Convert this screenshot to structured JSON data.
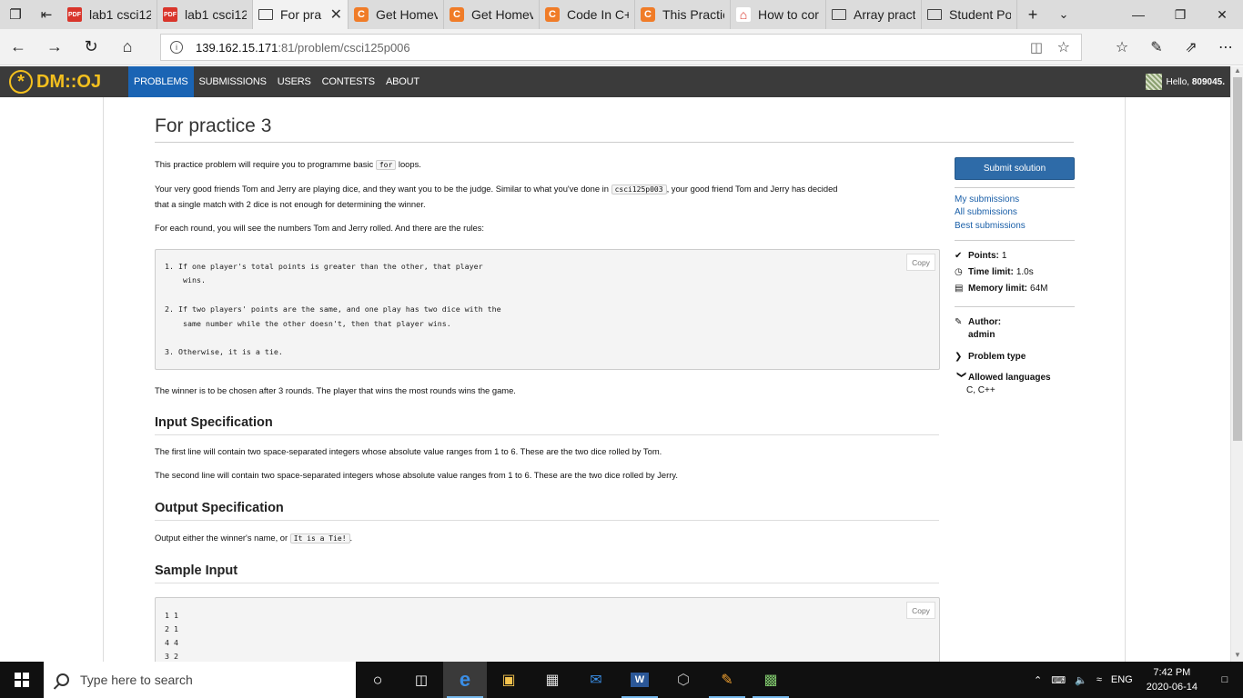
{
  "browser": {
    "tabs": [
      {
        "label": "lab1 csci12",
        "favicon": "pdf"
      },
      {
        "label": "lab1 csci12",
        "favicon": "pdf"
      },
      {
        "label": "For pra",
        "favicon": "page",
        "active": true
      },
      {
        "label": "Get Homev",
        "favicon": "c"
      },
      {
        "label": "Get Homev",
        "favicon": "c"
      },
      {
        "label": "Code In C+",
        "favicon": "c"
      },
      {
        "label": "This Practic",
        "favicon": "c"
      },
      {
        "label": "How to cor",
        "favicon": "acrobat"
      },
      {
        "label": "Array pract",
        "favicon": "page"
      },
      {
        "label": "Student Po",
        "favicon": "page"
      }
    ],
    "url_host": "139.162.15.171",
    "url_path": ":81/problem/csci125p006"
  },
  "site": {
    "logo_text": "DM::OJ",
    "nav": {
      "problems": "PROBLEMS",
      "submissions": "SUBMISSIONS",
      "users": "USERS",
      "contests": "CONTESTS",
      "about": "ABOUT"
    },
    "greeting_prefix": "Hello, ",
    "username": "809045."
  },
  "problem": {
    "title": "For practice 3",
    "intro_pre": "This practice problem will require you to programme basic ",
    "intro_code": "for",
    "intro_post": " loops.",
    "p2_pre": "Your very good friends Tom and Jerry are playing dice, and they want you to be the judge. Similar to what you've done in ",
    "p2_code": "csci125p003",
    "p2_post": ", your good friend Tom and Jerry has decided",
    "p2_line2": "that a single match with 2 dice is not enough for determining the winner.",
    "p3": "For each round, you will see the numbers Tom and Jerry rolled. And there are the rules:",
    "rules": [
      "1. If one player's total points is greater than the other, that player",
      "    wins.",
      "2. If two players' points are the same, and one play has two dice with the",
      "    same number while the other doesn't, then that player wins.",
      "3. Otherwise, it is a tie."
    ],
    "copy_label": "Copy",
    "p4": "The winner is to be chosen after 3 rounds. The player that wins the most rounds wins the game.",
    "input_heading": "Input Specification",
    "input_l1": "The first line will contain two space-separated integers whose absolute value ranges from 1 to 6. These are the two dice rolled by Tom.",
    "input_l2": "The second line will contain two space-separated integers whose absolute value ranges from 1 to 6. These are the two dice rolled by Jerry.",
    "output_heading": "Output Specification",
    "output_pre": "Output either the winner's name, or ",
    "output_code": "It is a Tie!",
    "output_post": ".",
    "sample_heading": "Sample Input",
    "sample_lines": [
      "1 1",
      "2 1",
      "4 4",
      "3 2"
    ]
  },
  "sidebar": {
    "submit": "Submit solution",
    "my_submissions": "My submissions",
    "all_submissions": "All submissions",
    "best_submissions": "Best submissions",
    "points_label": "Points:",
    "points_value": "1",
    "time_label": "Time limit:",
    "time_value": "1.0s",
    "memory_label": "Memory limit:",
    "memory_value": "64M",
    "author_label": "Author:",
    "author_value": "admin",
    "problem_type": "Problem type",
    "allowed_languages": "Allowed languages",
    "languages": "C, C++"
  },
  "taskbar": {
    "search_placeholder": "Type here to search",
    "lang": "ENG",
    "time": "7:42 PM",
    "date": "2020-06-14"
  }
}
